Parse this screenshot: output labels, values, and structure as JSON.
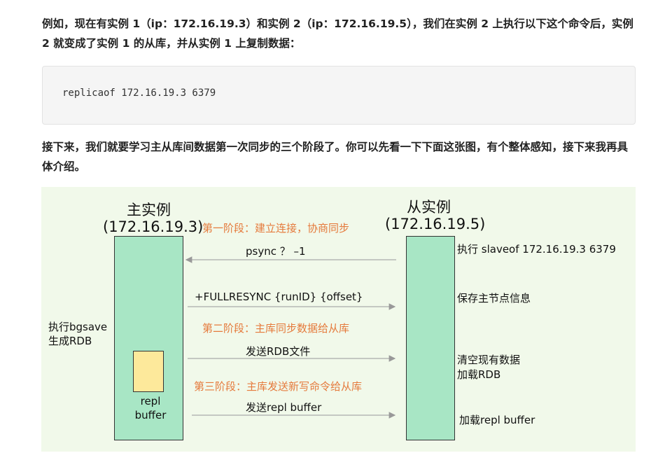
{
  "intro": {
    "p1": "例如，现在有实例 1（ip：172.16.19.3）和实例 2（ip：172.16.19.5），我们在实例 2 上执行以下这个命令后，实例 2 就变成了实例 1 的从库，并从实例 1 上复制数据：",
    "code": "replicaof 172.16.19.3 6379",
    "p2": "接下来，我们就要学习主从库间数据第一次同步的三个阶段了。你可以先看一下下面这张图，有个整体感知，接下来我再具体介绍。"
  },
  "diagram": {
    "master": {
      "title": "主实例",
      "ip": "(172.16.19.3)"
    },
    "slave": {
      "title": "从实例",
      "ip": "(172.16.19.5)"
    },
    "phases": {
      "phase1": "第一阶段：建立连接，协商同步",
      "phase2": "第二阶段：主库同步数据给从库",
      "phase3": "第三阶段：主库发送新写命令给从库"
    },
    "messages": {
      "psync": "psync ？ –1",
      "fullresync": "+FULLRESYNC {runID} {offset}",
      "send_rdb": "发送RDB文件",
      "send_repl": "发送repl buffer"
    },
    "master_notes": {
      "bgsave": "执行bgsave\n生成RDB",
      "buffer": "repl\nbuffer"
    },
    "slave_notes": {
      "slaveof": "执行 slaveof   172.16.19.3   6379",
      "save_info": "保存主节点信息",
      "clear_load": "清空现有数据\n加载RDB",
      "load_buffer": "加载repl buffer"
    },
    "colors": {
      "background": "#f1f9ea",
      "instance_bar": "#a8e6c5",
      "buffer_box": "#fde99b",
      "phase_text": "#e57a3c"
    }
  }
}
